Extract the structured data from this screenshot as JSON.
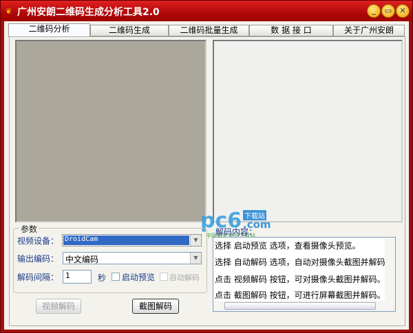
{
  "window": {
    "title": "广州安朗二维码生成分析工具2.0",
    "controls": [
      "minimize",
      "maximize",
      "close"
    ]
  },
  "tabs": [
    {
      "label": "二维码分析",
      "active": true
    },
    {
      "label": "二维码生成"
    },
    {
      "label": "二维码批量生成"
    },
    {
      "label": "数 据 接 口"
    },
    {
      "label": "关于广州安朗"
    }
  ],
  "params": {
    "legend": "参数",
    "device_label": "视频设备：",
    "device_value": "DroidCam",
    "encoding_label": "输出编码：",
    "encoding_value": "中文编码",
    "interval_label": "解码间隔：",
    "interval_value": "1",
    "interval_unit": "秒",
    "preview_label": "启动预览",
    "preview_checked": false,
    "auto_label": "自动解码",
    "auto_checked": false,
    "auto_enabled": false
  },
  "buttons": {
    "video_decode": "视频解码",
    "screenshot_decode": "截图解码"
  },
  "output": {
    "label": "解码内容：",
    "lines": [
      "选择 启动预览 选项，查看摄像头预览。",
      "选择 自动解码 选项，自动对摄像头截图并解码。",
      "点击 视频解码 按钮，可对摄像头截图并解码。",
      "点击 截图解码 按钮，可进行屏幕截图并解码。"
    ]
  },
  "watermark": {
    "brand": "pc6",
    "sub1": "下载站",
    "sub2": ".com",
    "tagline": "中国最安全的下载站"
  }
}
